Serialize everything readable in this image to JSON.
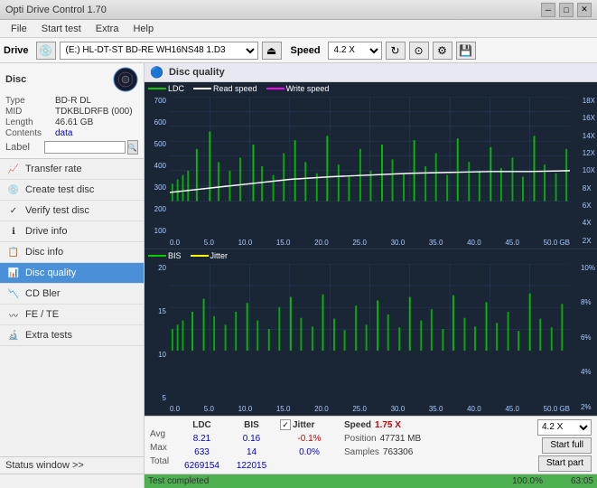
{
  "app": {
    "title": "Opti Drive Control 1.70",
    "titlebar_controls": [
      "minimize",
      "maximize",
      "close"
    ]
  },
  "menubar": {
    "items": [
      "File",
      "Start test",
      "Extra",
      "Help"
    ]
  },
  "drivebar": {
    "drive_label": "Drive",
    "drive_value": "(E:) HL-DT-ST BD-RE  WH16NS48 1.D3",
    "speed_label": "Speed",
    "speed_value": "4.2 X"
  },
  "disc": {
    "title": "Disc",
    "type_label": "Type",
    "type_value": "BD-R DL",
    "mid_label": "MID",
    "mid_value": "TDKBLDRFB (000)",
    "length_label": "Length",
    "length_value": "46.61 GB",
    "contents_label": "Contents",
    "contents_value": "data",
    "label_label": "Label",
    "label_value": ""
  },
  "sidebar": {
    "items": [
      {
        "id": "transfer-rate",
        "label": "Transfer rate",
        "icon": "📈"
      },
      {
        "id": "create-test-disc",
        "label": "Create test disc",
        "icon": "💿"
      },
      {
        "id": "verify-test-disc",
        "label": "Verify test disc",
        "icon": "✓"
      },
      {
        "id": "drive-info",
        "label": "Drive info",
        "icon": "ℹ"
      },
      {
        "id": "disc-info",
        "label": "Disc info",
        "icon": "📋"
      },
      {
        "id": "disc-quality",
        "label": "Disc quality",
        "icon": "📊",
        "active": true
      },
      {
        "id": "cd-bler",
        "label": "CD Bler",
        "icon": "📉"
      },
      {
        "id": "fe-te",
        "label": "FE / TE",
        "icon": "〰"
      },
      {
        "id": "extra-tests",
        "label": "Extra tests",
        "icon": "🔬"
      }
    ]
  },
  "content": {
    "header_title": "Disc quality",
    "chart1": {
      "legend": [
        {
          "label": "LDC",
          "color": "#00aa00"
        },
        {
          "label": "Read speed",
          "color": "#ffffff"
        },
        {
          "label": "Write speed",
          "color": "#ff00ff"
        }
      ],
      "left_axis": [
        "700",
        "600",
        "500",
        "400",
        "300",
        "200",
        "100"
      ],
      "right_axis": [
        "18X",
        "16X",
        "14X",
        "12X",
        "10X",
        "8X",
        "6X",
        "4X",
        "2X"
      ],
      "bottom_axis": [
        "0.0",
        "5.0",
        "10.0",
        "15.0",
        "20.0",
        "25.0",
        "30.0",
        "35.0",
        "40.0",
        "45.0",
        "50.0 GB"
      ]
    },
    "chart2": {
      "legend": [
        {
          "label": "BIS",
          "color": "#00aa00"
        },
        {
          "label": "Jitter",
          "color": "#ffff00"
        }
      ],
      "left_axis": [
        "20",
        "15",
        "10",
        "5"
      ],
      "right_axis": [
        "10%",
        "8%",
        "6%",
        "4%",
        "2%"
      ],
      "bottom_axis": [
        "0.0",
        "5.0",
        "10.0",
        "15.0",
        "20.0",
        "25.0",
        "30.0",
        "35.0",
        "40.0",
        "45.0",
        "50.0 GB"
      ]
    }
  },
  "stats": {
    "ldc_label": "LDC",
    "bis_label": "BIS",
    "jitter_label": "Jitter",
    "jitter_checked": true,
    "speed_label": "Speed",
    "speed_value": "1.75 X",
    "speed_select": "4.2 X",
    "avg_label": "Avg",
    "max_label": "Max",
    "total_label": "Total",
    "ldc_avg": "8.21",
    "ldc_max": "633",
    "ldc_total": "6269154",
    "bis_avg": "0.16",
    "bis_max": "14",
    "bis_total": "122015",
    "jitter_avg": "-0.1%",
    "jitter_max": "0.0%",
    "jitter_total": "",
    "position_label": "Position",
    "position_value": "47731 MB",
    "samples_label": "Samples",
    "samples_value": "763306",
    "start_full_btn": "Start full",
    "start_part_btn": "Start part"
  },
  "statusbar": {
    "status_window_label": "Status window >>",
    "progress_pct": "100.0%",
    "progress_width": 100,
    "status_text": "Test completed",
    "time_text": "63:05"
  }
}
